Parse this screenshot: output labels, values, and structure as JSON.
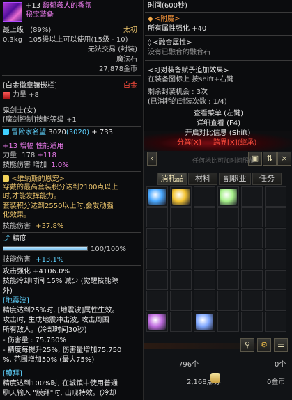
{
  "item": {
    "enhance": "+13",
    "name": "馥郁袭人的香氛",
    "rarity": "秘宝装备",
    "min_level_label": "最上级",
    "min_level_pct": "(89%)",
    "grade": "太初",
    "weight": "0.3kg",
    "level_req": "105级以上可以使用(15级 - 10)",
    "trade": "无法交易 (封装)",
    "type": "魔法石",
    "price": "27,878金币",
    "emblem_header": "[白金徽章镶嵌栏]",
    "emblem_tag": "白金",
    "emblem_stat": "力量 +8",
    "job_name": "鬼剑士(女)",
    "job_skill": "[魔剑控制]技能等级 +1",
    "adventurer_label": "冒险家名望",
    "adventurer_value": "3020",
    "adventurer_inner": "(3020)",
    "adventurer_bonus": "+ 733",
    "amp_line": "+13  增幅 性能适用",
    "amp_stat_label": "力量",
    "amp_stat_base": "178",
    "amp_stat_bonus": "+118",
    "skill_dmg_label": "技能伤害 增加",
    "skill_dmg_value": "1.0%",
    "grace_header": "<维纳斯的恩宠>",
    "grace_desc1": "穿戴的最高套装积分达到2100点以上",
    "grace_desc2": "时,才能发挥能力。",
    "grace_desc3": "套装积分达到2550以上时,会发动强",
    "grace_desc4": "化效果。",
    "grace_skill": "技能伤害",
    "grace_skill_value": "+37.8%",
    "precision_label": "精度",
    "precision_value": "100/100%",
    "precision_fill": 1.0,
    "precision_skill": "技能伤害",
    "precision_skill_value": "+13.1%",
    "atk_line": "攻击强化 +4106.0%",
    "cd_line1": "技能冷却时间 15% 减少 (觉醒技能除",
    "cd_line2": "外)",
    "quake_header": "[地震波]",
    "quake1": "精度达到25%时, [地震波]属性生效。",
    "quake2": "攻击时, 生成地震冲击波, 攻击周围",
    "quake3": "所有敌人。(冷却时间30秒)",
    "quake4": "- 伤害量 : 75,750%",
    "quake5": "- 精度每提升25%, 伤害量增加75,750",
    "quake6": "%, 范围增加50% (最大75%)",
    "bless_header": "[膜拜]",
    "bless1": "精度达到100%时, 在城镇中使用普通",
    "bless2": "聊天输入 \"膜拜\"时, 出现特效。(冷却"
  },
  "tooltip2": {
    "time": "时间(600秒)",
    "appendix_header": "<附魔>",
    "appendix_stat": "所有属性强化 +40",
    "fusion_header": "<融合属性>",
    "fusion_text": "没有已融合的融合石",
    "bonus_header": "<可对装备赋予追加效果>",
    "bonus_text": "在装备图标上 按shift+右键",
    "seal_count": "剩余封装机会 : 3次",
    "seal_used": "(已消耗的封装次数 : 1/4)",
    "menu_view": "查看菜单 (左键)",
    "menu_detail": "详细查看 (F4)",
    "menu_compare": "开启对比信息 (Shift)",
    "menu_split": "分解[X]",
    "menu_cross": "跨界[X](继承)"
  },
  "inventory": {
    "tabs": [
      "消耗品",
      "材料",
      "副职业",
      "任务"
    ],
    "active_tab": 0,
    "ghost_text": "任何地比可加时间服放",
    "slots_used": "796个",
    "points": "2,168点券",
    "gold": "0金币",
    "count_right": "0个",
    "item_colors": {
      "a": "#4aa8ff",
      "b": "#f4c433",
      "c": "#a6f08a",
      "d": "#c06de0",
      "e": "#7fa7ff"
    }
  }
}
